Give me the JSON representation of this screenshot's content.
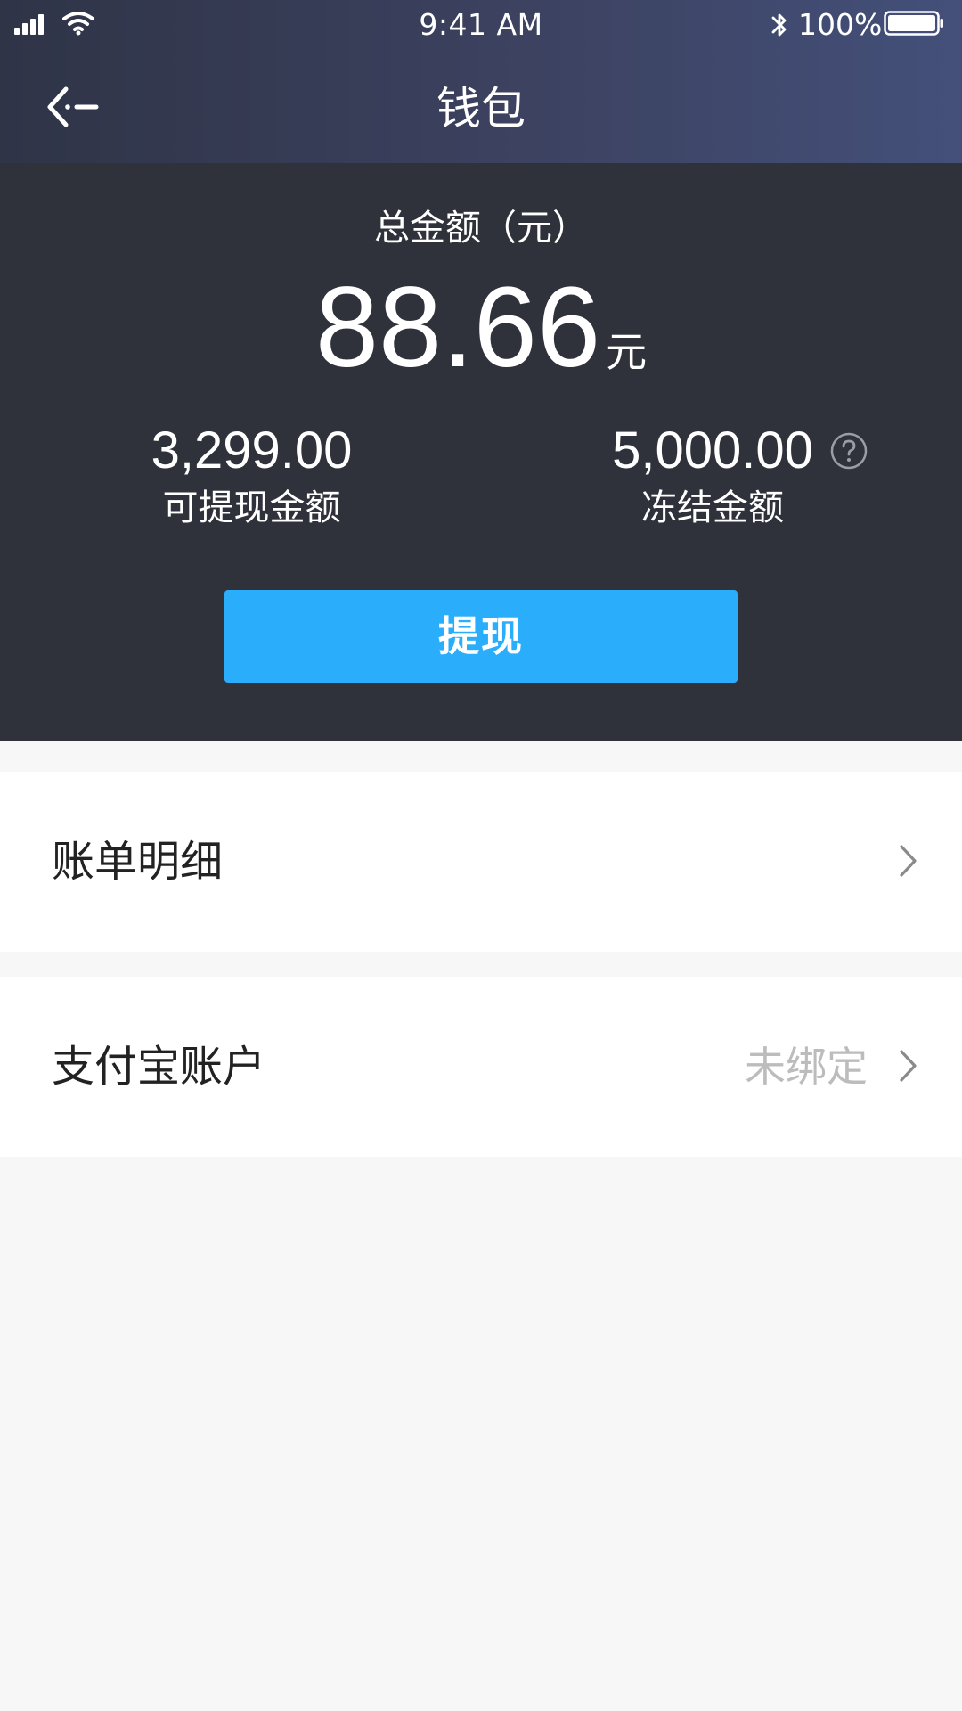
{
  "status_bar": {
    "time": "9:41 AM",
    "battery": "100%",
    "icons": [
      "signal-icon",
      "wifi-icon",
      "bluetooth-icon",
      "battery-icon"
    ]
  },
  "nav": {
    "title": "钱包",
    "back_icon": "back-arrow-icon"
  },
  "wallet": {
    "total_label": "总金额（元）",
    "total_amount": "88.66",
    "total_unit": "元",
    "withdrawable_amount": "3,299.00",
    "withdrawable_label": "可提现金额",
    "frozen_amount": "5,000.00",
    "frozen_label": "冻结金额",
    "help_icon": "question-circle-icon",
    "withdraw_button": "提现"
  },
  "list": {
    "items": [
      {
        "label": "账单明细",
        "value": "",
        "icon": "chevron-right-icon"
      },
      {
        "label": "支付宝账户",
        "value": "未绑定",
        "icon": "chevron-right-icon"
      }
    ]
  },
  "colors": {
    "header_start": "#2f3447",
    "header_end": "#44507a",
    "panel_bg": "#2f323a",
    "accent": "#2aaefc",
    "page_bg": "#f7f7f7",
    "muted_text": "#bcbcbc"
  }
}
